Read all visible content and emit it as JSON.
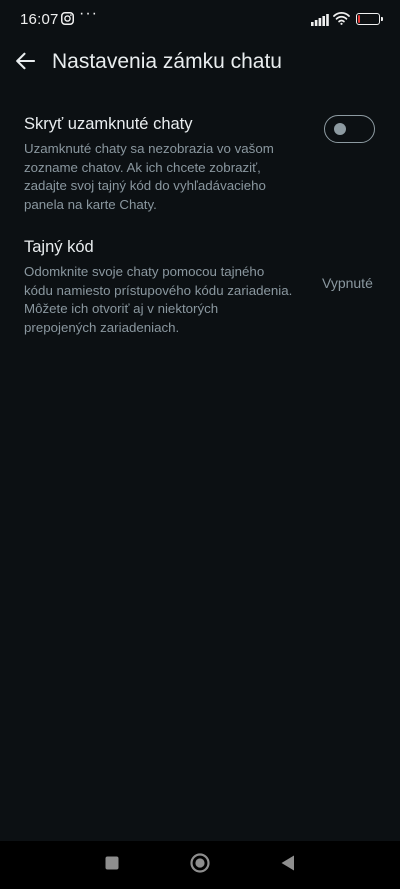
{
  "status_bar": {
    "time": "16:07",
    "dots": "···",
    "battery": "13",
    "battery_fraction": 0.13,
    "icons": [
      "instagram-icon",
      "signal-icon",
      "wifi-icon",
      "battery-icon"
    ]
  },
  "app_bar": {
    "title": "Nastavenia zámku chatu",
    "back_icon": "arrow-left-icon"
  },
  "settings": {
    "hide_locked": {
      "title": "Skryť uzamknuté chaty",
      "description": "Uzamknuté chaty sa nezobrazia vo vašom zozname chatov. Ak ich chcete zobraziť, zadajte svoj tajný kód do vyhľadávacieho panela na karte Chaty.",
      "toggle_on": false
    },
    "secret_code": {
      "title": "Tajný kód",
      "description": "Odomknite svoje chaty pomocou tajného kódu namiesto prístupového kódu zariadenia. Môžete ich otvoriť aj v niektorých prepojených zariadeniach.",
      "value": "Vypnuté"
    }
  },
  "nav_bar": {
    "icons": [
      "recents-square-icon",
      "home-circle-icon",
      "back-triangle-icon"
    ]
  },
  "colors": {
    "background": "#0c1013",
    "text_primary": "#e9edef",
    "text_secondary": "#8a979f",
    "toggle_off": "#8d9aa1",
    "battery_low": "#e53935"
  }
}
